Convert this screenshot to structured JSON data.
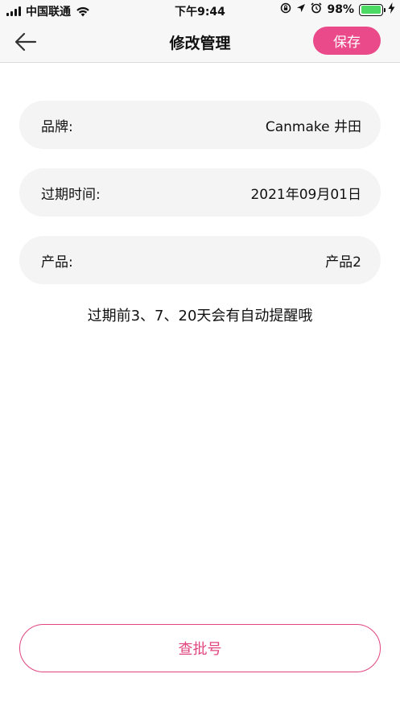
{
  "status_bar": {
    "carrier": "中国联通",
    "time": "下午9:44",
    "battery_percent": "98%",
    "battery_level": 0.98
  },
  "nav": {
    "title": "修改管理",
    "save_label": "保存"
  },
  "fields": [
    {
      "label": "品牌:",
      "value": "Canmake 井田"
    },
    {
      "label": "过期时间:",
      "value": "2021年09月01日"
    },
    {
      "label": "产品:",
      "value": "产品2"
    }
  ],
  "notice": "过期前3、7、20天会有自动提醒哦",
  "check_button": "查批号",
  "colors": {
    "accent": "#ea4a8a",
    "field_bg": "#f4f4f4",
    "nav_bg": "#f7f7f7"
  }
}
